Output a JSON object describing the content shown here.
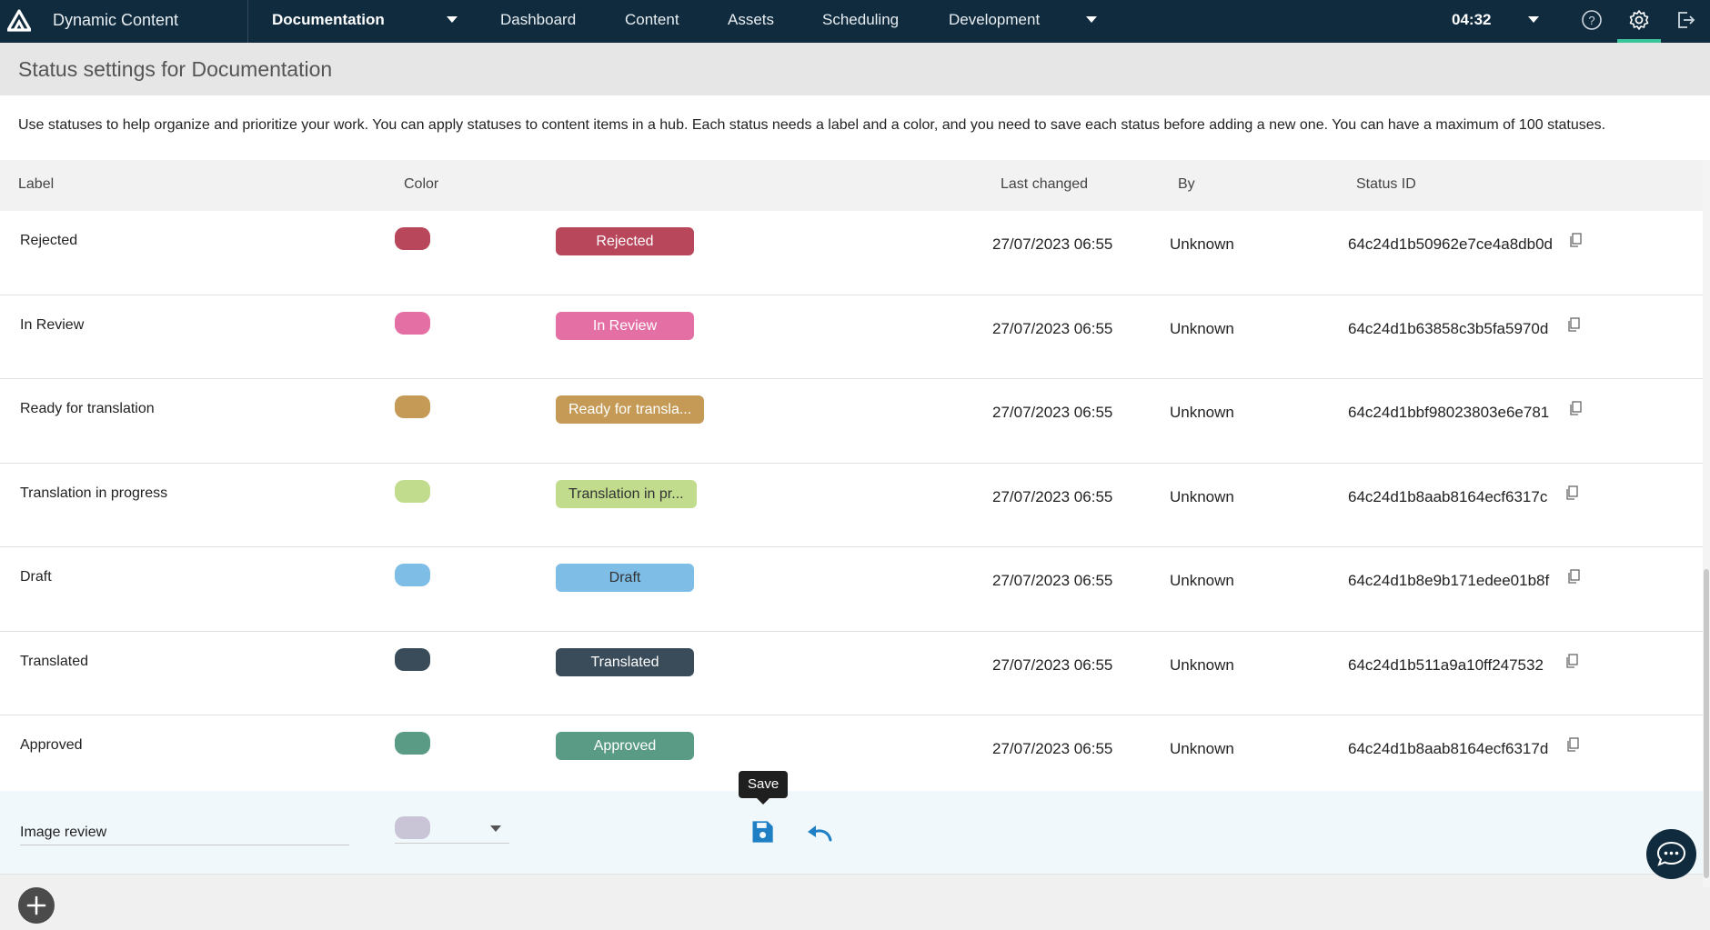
{
  "nav": {
    "app_name": "Dynamic Content",
    "hub": "Documentation",
    "items": [
      "Dashboard",
      "Content",
      "Assets",
      "Scheduling",
      "Development"
    ],
    "time": "04:32",
    "icons": [
      "help-icon",
      "settings-icon",
      "logout-icon"
    ],
    "colors": {
      "bg": "#0f2b3d",
      "accent": "#3bc49a"
    }
  },
  "page": {
    "title": "Status settings for Documentation",
    "description": "Use statuses to help organize and prioritize your work. You can apply statuses to content items in a hub. Each status needs a label and a color, and you need to save each status before adding a new one. You can have a maximum of 100 statuses."
  },
  "table": {
    "headers": {
      "label": "Label",
      "color": "Color",
      "last_changed": "Last changed",
      "by": "By",
      "status_id": "Status ID"
    },
    "rows": [
      {
        "label": "Rejected",
        "color": "#b9475c",
        "pill": "Rejected",
        "changed": "27/07/2023 06:55",
        "by": "Unknown",
        "id": "64c24d1b50962e7ce4a8db0d"
      },
      {
        "label": "In Review",
        "color": "#e46fa5",
        "pill": "In Review",
        "changed": "27/07/2023 06:55",
        "by": "Unknown",
        "id": "64c24d1b63858c3b5fa5970d"
      },
      {
        "label": "Ready for translation",
        "color": "#c49a56",
        "pill": "Ready for transla...",
        "changed": "27/07/2023 06:55",
        "by": "Unknown",
        "id": "64c24d1bbf98023803e6e781"
      },
      {
        "label": "Translation in progress",
        "color": "#c2dc8e",
        "pill": "Translation in pr...",
        "changed": "27/07/2023 06:55",
        "by": "Unknown",
        "id": "64c24d1b8aab8164ecf6317c",
        "dark_text": true
      },
      {
        "label": "Draft",
        "color": "#7dbde6",
        "pill": "Draft",
        "changed": "27/07/2023 06:55",
        "by": "Unknown",
        "id": "64c24d1b8e9b171edee01b8f",
        "dark_text": true
      },
      {
        "label": "Translated",
        "color": "#3a4c5a",
        "pill": "Translated",
        "changed": "27/07/2023 06:55",
        "by": "Unknown",
        "id": "64c24d1b511a9a10ff247532"
      },
      {
        "label": "Approved",
        "color": "#5a9b86",
        "pill": "Approved",
        "changed": "27/07/2023 06:55",
        "by": "Unknown",
        "id": "64c24d1b8aab8164ecf6317d"
      }
    ]
  },
  "edit_row": {
    "label_value": "Image review",
    "selected_color": "#c9c4d6",
    "save_tooltip": "Save"
  }
}
